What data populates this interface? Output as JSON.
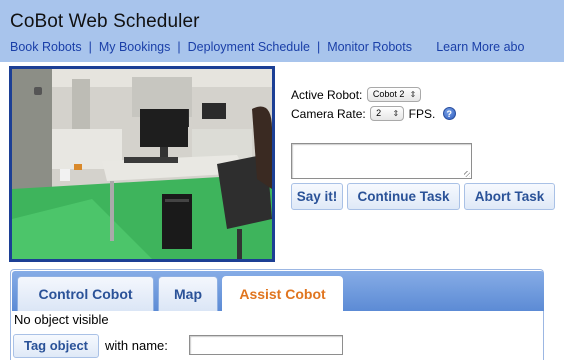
{
  "header": {
    "title": "CoBot Web Scheduler",
    "nav": [
      "Book Robots",
      "My Bookings",
      "Deployment Schedule",
      "Monitor Robots",
      "Learn More abo"
    ],
    "separator": "|"
  },
  "camera": {
    "icon": "camera-feed"
  },
  "controls": {
    "active_robot_label": "Active Robot:",
    "active_robot_value": "Cobot 2",
    "camera_rate_label": "Camera Rate:",
    "camera_rate_value": "2",
    "fps_label": "FPS.",
    "help_glyph": "?",
    "select_arrows": "⇕",
    "speech_value": ""
  },
  "buttons": {
    "say": "Say it!",
    "continue": "Continue Task",
    "abort": "Abort Task"
  },
  "tabs": [
    {
      "label": "Control Cobot",
      "active": false
    },
    {
      "label": "Map",
      "active": false
    },
    {
      "label": "Assist Cobot",
      "active": true
    }
  ],
  "assist": {
    "status": "No object visible",
    "tag_button": "Tag object",
    "with_name_label": "with name:",
    "name_value": ""
  },
  "colors": {
    "header_bg": "#a8c4ec",
    "link": "#1a3fa8",
    "button_text": "#2a5298",
    "active_tab_text": "#e0751f",
    "camera_border": "#1c3f95"
  }
}
